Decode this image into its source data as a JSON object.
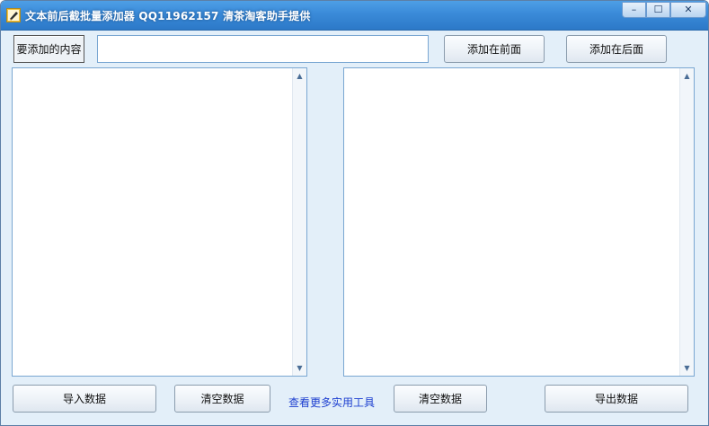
{
  "window": {
    "title": "文本前后截批量添加器 QQ11962157 清茶淘客助手提供",
    "controls": {
      "minimize": "–",
      "maximize": "☐",
      "close": "✕"
    }
  },
  "top_bar": {
    "label": "要添加的内容",
    "input_value": "",
    "add_front_label": "添加在前面",
    "add_back_label": "添加在后面"
  },
  "left_panel": {
    "content": ""
  },
  "right_panel": {
    "content": ""
  },
  "bottom_bar": {
    "import_label": "导入数据",
    "clear_left_label": "清空数据",
    "more_tools_link": "查看更多实用工具",
    "clear_right_label": "清空数据",
    "export_label": "导出数据"
  },
  "icons": {
    "app": "pencil-paper-icon",
    "scroll_up": "chevron-up-icon",
    "scroll_down": "chevron-down-icon"
  },
  "colors": {
    "titlebar": "#3a8ad8",
    "window_bg": "#e3eff9",
    "link": "#1d3fd0",
    "field_border": "#7aa7d2"
  }
}
